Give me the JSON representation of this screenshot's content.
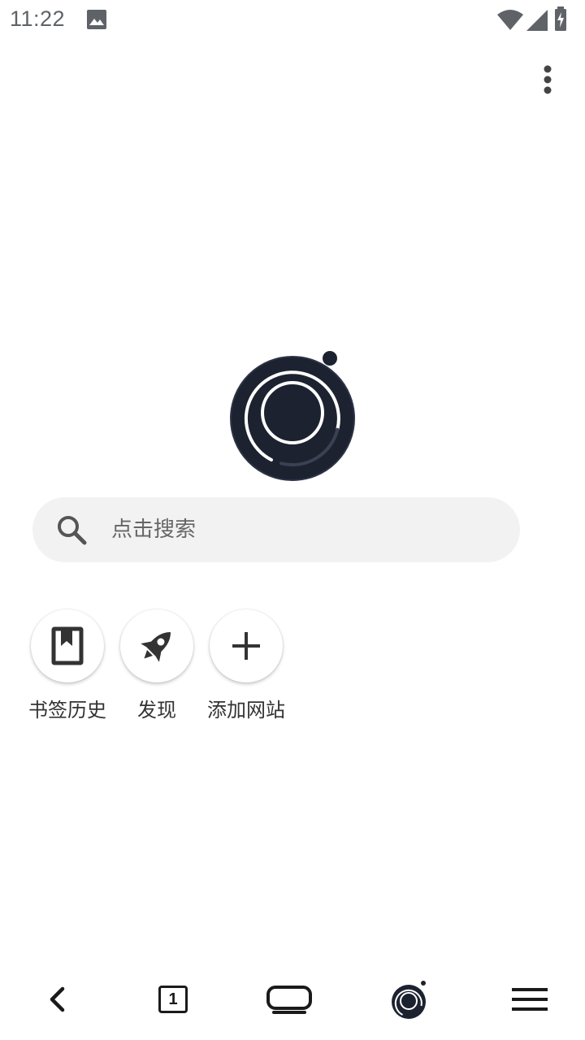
{
  "status_bar": {
    "time": "11:22",
    "icons": [
      "image-icon",
      "wifi-icon",
      "signal-icon",
      "battery-charging-icon"
    ]
  },
  "header": {
    "menu_icon": "more-vert-icon"
  },
  "logo": {
    "icon": "browser-logo-icon",
    "color": "#1c2230"
  },
  "search": {
    "placeholder": "点击搜索",
    "icon": "search-icon"
  },
  "shortcuts": [
    {
      "label": "书签历史",
      "icon": "bookmark-icon"
    },
    {
      "label": "发现",
      "icon": "rocket-icon"
    },
    {
      "label": "添加网站",
      "icon": "plus-icon"
    }
  ],
  "bottom_nav": {
    "back_icon": "back-icon",
    "tab_count": "1",
    "tabs_icon": "tabs-icon",
    "window_icon": "window-icon",
    "home_icon": "home-logo-icon",
    "menu_icon": "hamburger-menu-icon"
  },
  "colors": {
    "accent": "#1c2230",
    "search_background": "#f2f2f2",
    "icon_dark": "#333333"
  }
}
